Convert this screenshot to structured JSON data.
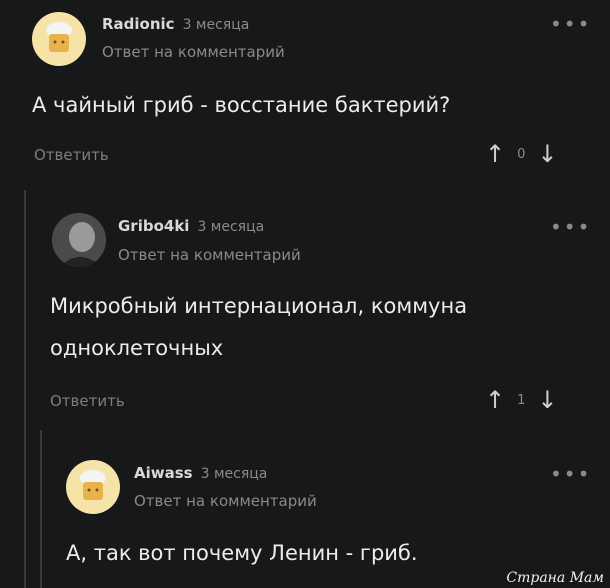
{
  "comments": [
    {
      "author": "Radionic",
      "time": "3 месяца",
      "reply_to": "Ответ на комментарий",
      "text": "А чайный гриб - восстание бактерий?",
      "reply_label": "Ответить",
      "votes": "0"
    },
    {
      "author": "Gribo4ki",
      "time": "3 месяца",
      "reply_to": "Ответ на комментарий",
      "text_line1": "Микробный интернационал, коммуна",
      "text_line2": "одноклеточных",
      "reply_label": "Ответить",
      "votes": "1"
    },
    {
      "author": "Aiwass",
      "time": "3 месяца",
      "reply_to": "Ответ на комментарий",
      "text": "А, так вот почему Ленин - гриб."
    }
  ],
  "menu_glyph": "•••",
  "watermark": "Страна Мам"
}
